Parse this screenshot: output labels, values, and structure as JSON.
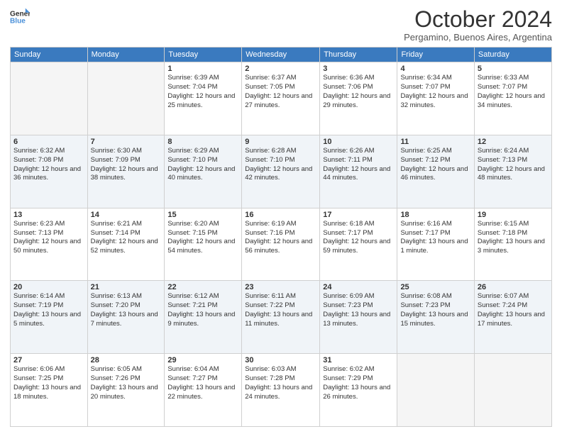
{
  "header": {
    "logo_general": "General",
    "logo_blue": "Blue",
    "title": "October 2024",
    "location": "Pergamino, Buenos Aires, Argentina"
  },
  "days_of_week": [
    "Sunday",
    "Monday",
    "Tuesday",
    "Wednesday",
    "Thursday",
    "Friday",
    "Saturday"
  ],
  "weeks": [
    [
      {
        "day": "",
        "sunrise": "",
        "sunset": "",
        "daylight": ""
      },
      {
        "day": "",
        "sunrise": "",
        "sunset": "",
        "daylight": ""
      },
      {
        "day": "1",
        "sunrise": "Sunrise: 6:39 AM",
        "sunset": "Sunset: 7:04 PM",
        "daylight": "Daylight: 12 hours and 25 minutes."
      },
      {
        "day": "2",
        "sunrise": "Sunrise: 6:37 AM",
        "sunset": "Sunset: 7:05 PM",
        "daylight": "Daylight: 12 hours and 27 minutes."
      },
      {
        "day": "3",
        "sunrise": "Sunrise: 6:36 AM",
        "sunset": "Sunset: 7:06 PM",
        "daylight": "Daylight: 12 hours and 29 minutes."
      },
      {
        "day": "4",
        "sunrise": "Sunrise: 6:34 AM",
        "sunset": "Sunset: 7:07 PM",
        "daylight": "Daylight: 12 hours and 32 minutes."
      },
      {
        "day": "5",
        "sunrise": "Sunrise: 6:33 AM",
        "sunset": "Sunset: 7:07 PM",
        "daylight": "Daylight: 12 hours and 34 minutes."
      }
    ],
    [
      {
        "day": "6",
        "sunrise": "Sunrise: 6:32 AM",
        "sunset": "Sunset: 7:08 PM",
        "daylight": "Daylight: 12 hours and 36 minutes."
      },
      {
        "day": "7",
        "sunrise": "Sunrise: 6:30 AM",
        "sunset": "Sunset: 7:09 PM",
        "daylight": "Daylight: 12 hours and 38 minutes."
      },
      {
        "day": "8",
        "sunrise": "Sunrise: 6:29 AM",
        "sunset": "Sunset: 7:10 PM",
        "daylight": "Daylight: 12 hours and 40 minutes."
      },
      {
        "day": "9",
        "sunrise": "Sunrise: 6:28 AM",
        "sunset": "Sunset: 7:10 PM",
        "daylight": "Daylight: 12 hours and 42 minutes."
      },
      {
        "day": "10",
        "sunrise": "Sunrise: 6:26 AM",
        "sunset": "Sunset: 7:11 PM",
        "daylight": "Daylight: 12 hours and 44 minutes."
      },
      {
        "day": "11",
        "sunrise": "Sunrise: 6:25 AM",
        "sunset": "Sunset: 7:12 PM",
        "daylight": "Daylight: 12 hours and 46 minutes."
      },
      {
        "day": "12",
        "sunrise": "Sunrise: 6:24 AM",
        "sunset": "Sunset: 7:13 PM",
        "daylight": "Daylight: 12 hours and 48 minutes."
      }
    ],
    [
      {
        "day": "13",
        "sunrise": "Sunrise: 6:23 AM",
        "sunset": "Sunset: 7:13 PM",
        "daylight": "Daylight: 12 hours and 50 minutes."
      },
      {
        "day": "14",
        "sunrise": "Sunrise: 6:21 AM",
        "sunset": "Sunset: 7:14 PM",
        "daylight": "Daylight: 12 hours and 52 minutes."
      },
      {
        "day": "15",
        "sunrise": "Sunrise: 6:20 AM",
        "sunset": "Sunset: 7:15 PM",
        "daylight": "Daylight: 12 hours and 54 minutes."
      },
      {
        "day": "16",
        "sunrise": "Sunrise: 6:19 AM",
        "sunset": "Sunset: 7:16 PM",
        "daylight": "Daylight: 12 hours and 56 minutes."
      },
      {
        "day": "17",
        "sunrise": "Sunrise: 6:18 AM",
        "sunset": "Sunset: 7:17 PM",
        "daylight": "Daylight: 12 hours and 59 minutes."
      },
      {
        "day": "18",
        "sunrise": "Sunrise: 6:16 AM",
        "sunset": "Sunset: 7:17 PM",
        "daylight": "Daylight: 13 hours and 1 minute."
      },
      {
        "day": "19",
        "sunrise": "Sunrise: 6:15 AM",
        "sunset": "Sunset: 7:18 PM",
        "daylight": "Daylight: 13 hours and 3 minutes."
      }
    ],
    [
      {
        "day": "20",
        "sunrise": "Sunrise: 6:14 AM",
        "sunset": "Sunset: 7:19 PM",
        "daylight": "Daylight: 13 hours and 5 minutes."
      },
      {
        "day": "21",
        "sunrise": "Sunrise: 6:13 AM",
        "sunset": "Sunset: 7:20 PM",
        "daylight": "Daylight: 13 hours and 7 minutes."
      },
      {
        "day": "22",
        "sunrise": "Sunrise: 6:12 AM",
        "sunset": "Sunset: 7:21 PM",
        "daylight": "Daylight: 13 hours and 9 minutes."
      },
      {
        "day": "23",
        "sunrise": "Sunrise: 6:11 AM",
        "sunset": "Sunset: 7:22 PM",
        "daylight": "Daylight: 13 hours and 11 minutes."
      },
      {
        "day": "24",
        "sunrise": "Sunrise: 6:09 AM",
        "sunset": "Sunset: 7:23 PM",
        "daylight": "Daylight: 13 hours and 13 minutes."
      },
      {
        "day": "25",
        "sunrise": "Sunrise: 6:08 AM",
        "sunset": "Sunset: 7:23 PM",
        "daylight": "Daylight: 13 hours and 15 minutes."
      },
      {
        "day": "26",
        "sunrise": "Sunrise: 6:07 AM",
        "sunset": "Sunset: 7:24 PM",
        "daylight": "Daylight: 13 hours and 17 minutes."
      }
    ],
    [
      {
        "day": "27",
        "sunrise": "Sunrise: 6:06 AM",
        "sunset": "Sunset: 7:25 PM",
        "daylight": "Daylight: 13 hours and 18 minutes."
      },
      {
        "day": "28",
        "sunrise": "Sunrise: 6:05 AM",
        "sunset": "Sunset: 7:26 PM",
        "daylight": "Daylight: 13 hours and 20 minutes."
      },
      {
        "day": "29",
        "sunrise": "Sunrise: 6:04 AM",
        "sunset": "Sunset: 7:27 PM",
        "daylight": "Daylight: 13 hours and 22 minutes."
      },
      {
        "day": "30",
        "sunrise": "Sunrise: 6:03 AM",
        "sunset": "Sunset: 7:28 PM",
        "daylight": "Daylight: 13 hours and 24 minutes."
      },
      {
        "day": "31",
        "sunrise": "Sunrise: 6:02 AM",
        "sunset": "Sunset: 7:29 PM",
        "daylight": "Daylight: 13 hours and 26 minutes."
      },
      {
        "day": "",
        "sunrise": "",
        "sunset": "",
        "daylight": ""
      },
      {
        "day": "",
        "sunrise": "",
        "sunset": "",
        "daylight": ""
      }
    ]
  ]
}
